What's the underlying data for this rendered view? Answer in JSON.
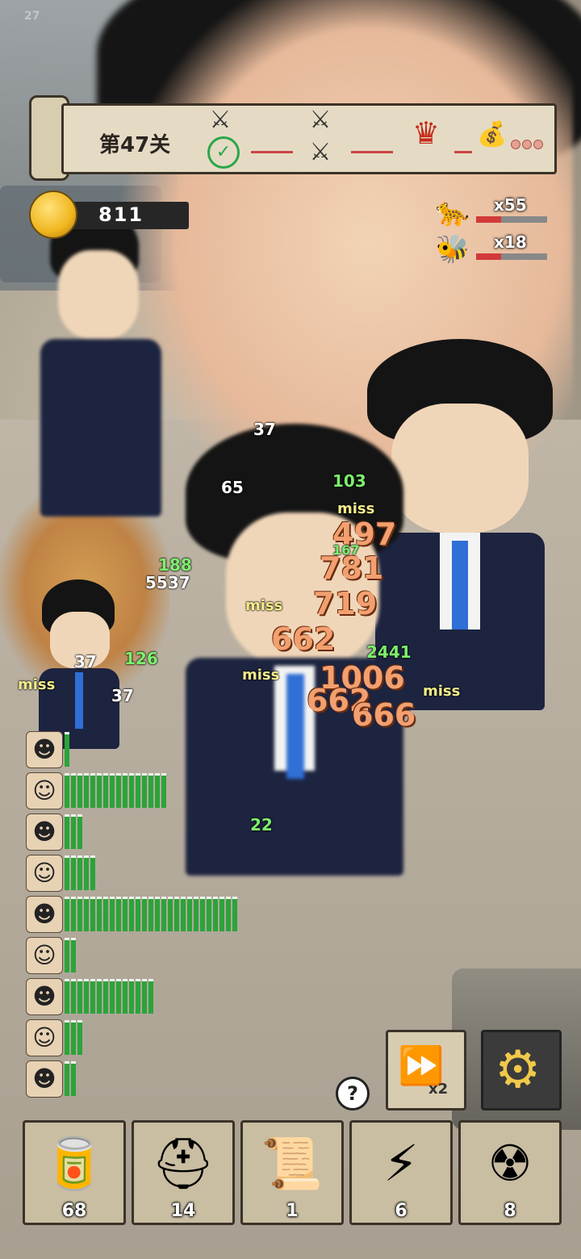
{
  "status": {
    "corner_number": "27"
  },
  "stage": {
    "level_label": "第47关"
  },
  "progress_nodes": [
    {
      "name": "battle-icon",
      "glyph": "⚔",
      "state": "done"
    },
    {
      "name": "battle-icon",
      "glyph": "⚔",
      "state": "current"
    },
    {
      "name": "battle-icon",
      "glyph": "⚔",
      "state": "unknown"
    },
    {
      "name": "boss-icon",
      "glyph": "♛",
      "state": "boss"
    },
    {
      "name": "money-bag-icon",
      "glyph": "💰",
      "state": "reward"
    }
  ],
  "coins": {
    "value": "811"
  },
  "enemies": [
    {
      "icon": "leopard-icon",
      "glyph": "🐆",
      "count": "x55",
      "hp_fraction": 0.35
    },
    {
      "icon": "bee-icon",
      "glyph": "🐝",
      "count": "x18",
      "hp_fraction": 0.35
    }
  ],
  "damage_numbers": [
    {
      "text": "37",
      "kind": "white"
    },
    {
      "text": "65",
      "kind": "white"
    },
    {
      "text": "103",
      "kind": "green"
    },
    {
      "text": "miss",
      "kind": "miss"
    },
    {
      "text": "497",
      "kind": "crit"
    },
    {
      "text": "188",
      "kind": "green"
    },
    {
      "text": "5537",
      "kind": "white"
    },
    {
      "text": "781",
      "kind": "crit"
    },
    {
      "text": "167",
      "kind": "green"
    },
    {
      "text": "719",
      "kind": "crit"
    },
    {
      "text": "miss",
      "kind": "miss"
    },
    {
      "text": "662",
      "kind": "crit"
    },
    {
      "text": "2441",
      "kind": "green"
    },
    {
      "text": "126",
      "kind": "green"
    },
    {
      "text": "37",
      "kind": "white"
    },
    {
      "text": "miss",
      "kind": "miss"
    },
    {
      "text": "37",
      "kind": "white"
    },
    {
      "text": "miss",
      "kind": "miss"
    },
    {
      "text": "1006",
      "kind": "crit"
    },
    {
      "text": "662",
      "kind": "crit"
    },
    {
      "text": "666",
      "kind": "crit"
    },
    {
      "text": "miss",
      "kind": "miss"
    },
    {
      "text": "22",
      "kind": "green"
    }
  ],
  "heroes": [
    {
      "name": "hero-spiky-hair",
      "glyph": "☻",
      "bars": 1
    },
    {
      "name": "hero-white-hair",
      "glyph": "☺",
      "bars": 16
    },
    {
      "name": "hero-boy",
      "glyph": "☻",
      "bars": 3
    },
    {
      "name": "hero-mouse-ears",
      "glyph": "☺",
      "bars": 5
    },
    {
      "name": "hero-orange-hair",
      "glyph": "☻",
      "bars": 27
    },
    {
      "name": "hero-pink-rabbit",
      "glyph": "☺",
      "bars": 2
    },
    {
      "name": "hero-suit-man",
      "glyph": "☻",
      "bars": 14
    },
    {
      "name": "hero-cat",
      "glyph": "☺",
      "bars": 3
    },
    {
      "name": "hero-cowboy-cat",
      "glyph": "☻",
      "bars": 2
    }
  ],
  "controls": {
    "speed_icon": "⏩",
    "speed_label": "x2",
    "settings_glyph": "⚙",
    "help_glyph": "?"
  },
  "items": [
    {
      "name": "cola-can",
      "glyph": "🥫",
      "count": "68"
    },
    {
      "name": "first-aid-kit",
      "glyph": "⛑",
      "count": "14"
    },
    {
      "name": "scroll",
      "glyph": "📜",
      "count": "1"
    },
    {
      "name": "lightning-charm",
      "glyph": "⚡",
      "count": "6"
    },
    {
      "name": "nuke-bomb",
      "glyph": "☢",
      "count": "8"
    }
  ],
  "colors": {
    "hp_bar": "#2ca33a",
    "enemy_hp": "#d23a3a",
    "crit": "#f2a070"
  }
}
